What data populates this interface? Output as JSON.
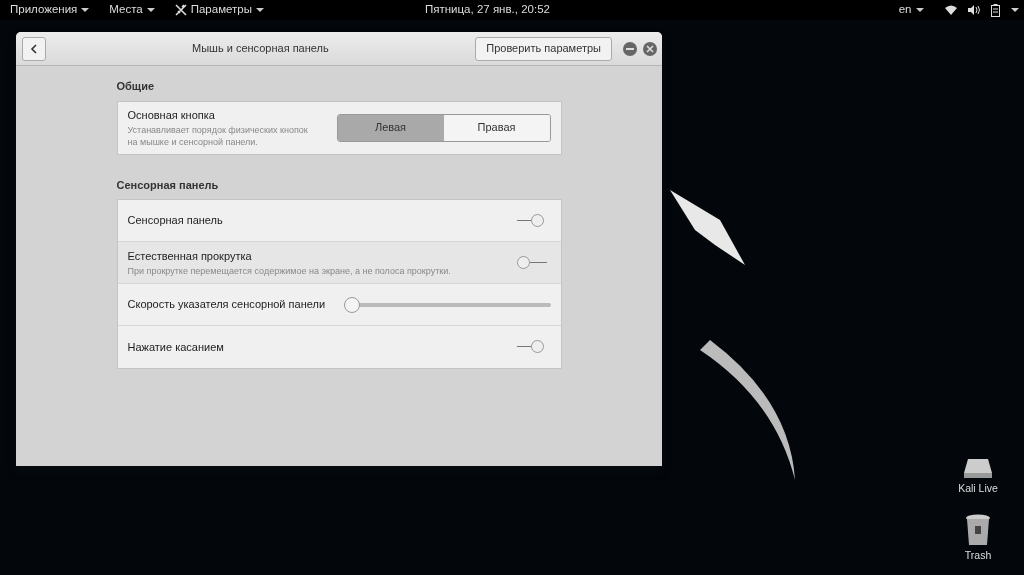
{
  "top_bar": {
    "menus": [
      {
        "label": "Приложения",
        "icon": false
      },
      {
        "label": "Места",
        "icon": false
      },
      {
        "label": "Параметры",
        "icon": true
      }
    ],
    "clock": "Пятница, 27 янв., 20:52",
    "language": "en"
  },
  "window": {
    "title": "Мышь и сенсорная панель",
    "test_button": "Проверить параметры",
    "sections": [
      {
        "heading": "Общие",
        "rows": [
          {
            "kind": "segmented",
            "label": "Основная кнопка",
            "description": "Устанавливает порядок физических кнопок\nна мышке и сенсорной панели.",
            "options": [
              {
                "label": "Левая",
                "selected": true
              },
              {
                "label": "Правая",
                "selected": false
              }
            ]
          }
        ]
      },
      {
        "heading": "Сенсорная панель",
        "rows": [
          {
            "kind": "switch",
            "label": "Сенсорная панель",
            "on": true
          },
          {
            "kind": "switch",
            "label": "Естественная прокрутка",
            "description": "При прокрутке перемещается содержимое на экране, а не полоса прокрутки.",
            "on": false
          },
          {
            "kind": "slider",
            "label": "Скорость указателя сенсорной панели",
            "level": 0.03
          },
          {
            "kind": "switch",
            "label": "Нажатие касанием",
            "on": true
          }
        ]
      }
    ]
  },
  "desktop_icons": [
    {
      "kind": "drive",
      "label": "Kali Live"
    },
    {
      "kind": "trash",
      "label": "Trash"
    }
  ]
}
